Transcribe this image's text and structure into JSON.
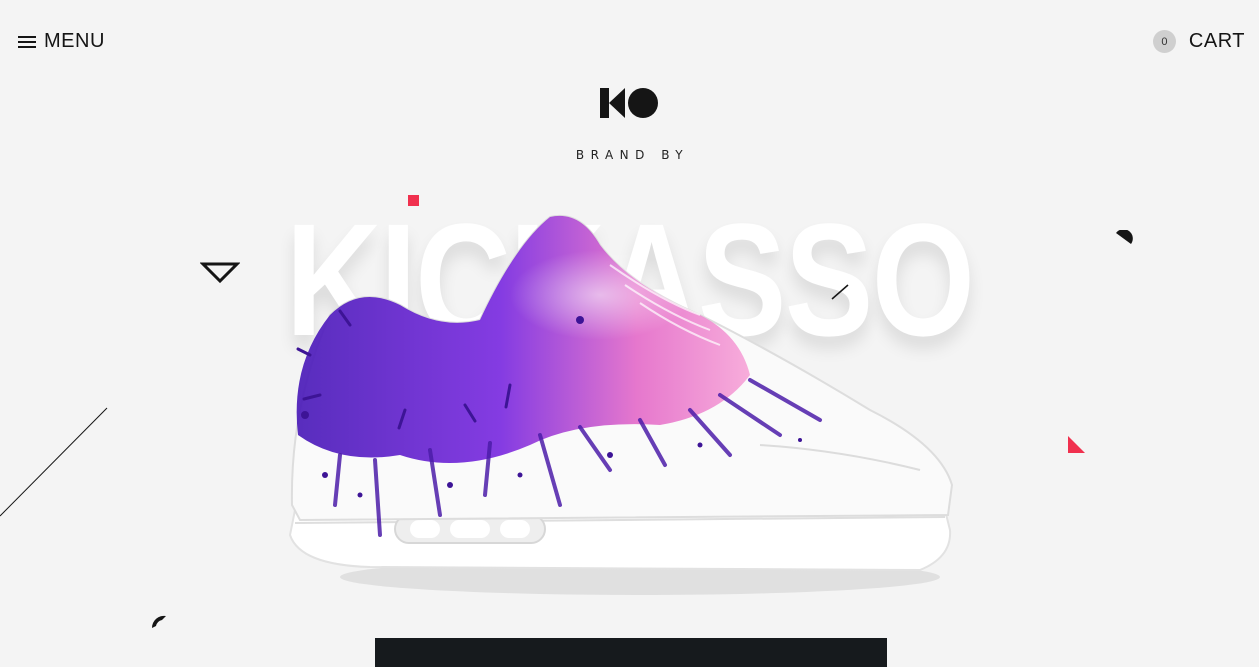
{
  "header": {
    "menu_label": "MENU",
    "menu_icon": "hamburger-icon",
    "cart_count": "0",
    "cart_label": "CART"
  },
  "hero": {
    "logo_icon": "ko-logo",
    "brand_by": "BRAND BY",
    "brand_name": "KICKASSO",
    "product_image": "splatter-sneaker"
  },
  "colors": {
    "background": "#f4f4f4",
    "text": "#151515",
    "accent_red": "#f0304e",
    "cta_bar": "#161a1d",
    "paint_purple": "#6a1fd1",
    "paint_pink": "#e86fc8"
  }
}
